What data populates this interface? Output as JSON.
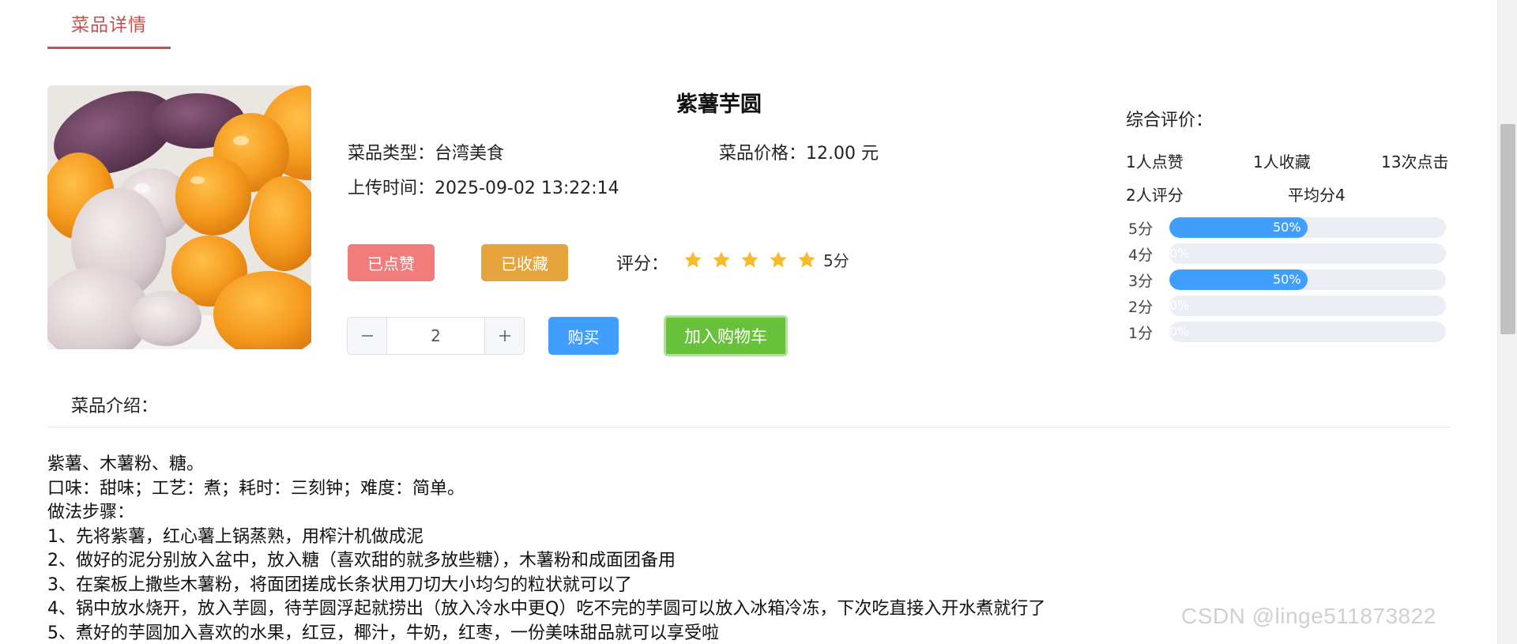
{
  "tab": {
    "label": "菜品详情"
  },
  "dish": {
    "title": "紫薯芋圆",
    "type_label": "菜品类型：",
    "type_value": "台湾美食",
    "price_label": "菜品价格：",
    "price_value": "12.00 元",
    "time_label": "上传时间：",
    "time_value": "2025-09-02 13:22:14"
  },
  "actions": {
    "liked_label": "已点赞",
    "favorited_label": "已收藏",
    "rating_label": "评分：",
    "rating_stars": 5,
    "rating_text": "5分",
    "quantity": "2",
    "buy_label": "购买",
    "cart_label": "加入购物车"
  },
  "summary": {
    "title": "综合评价：",
    "likes": "1人点赞",
    "favorites": "1人收藏",
    "clicks": "13次点击",
    "raters": "2人评分",
    "average": "平均分4",
    "bars": [
      {
        "label": "5分",
        "percent": 50,
        "text": "50%"
      },
      {
        "label": "4分",
        "percent": 0,
        "text": "0%"
      },
      {
        "label": "3分",
        "percent": 50,
        "text": "50%"
      },
      {
        "label": "2分",
        "percent": 0,
        "text": "0%"
      },
      {
        "label": "1分",
        "percent": 0,
        "text": "0%"
      }
    ]
  },
  "description": {
    "heading": "菜品介绍：",
    "lines": [
      "紫薯、木薯粉、糖。",
      "口味：甜味；工艺：煮；耗时：三刻钟；难度：简单。",
      "做法步骤：",
      "1、先将紫薯，红心薯上锅蒸熟，用榨汁机做成泥",
      "2、做好的泥分别放入盆中，放入糖（喜欢甜的就多放些糖），木薯粉和成面团备用",
      "3、在案板上撒些木薯粉，将面团搓成长条状用刀切大小均匀的粒状就可以了",
      "4、锅中放水烧开，放入芋圆，待芋圆浮起就捞出（放入冷水中更Q）吃不完的芋圆可以放入冰箱冷冻，下次吃直接入开水煮就行了",
      "5、煮好的芋圆加入喜欢的水果，红豆，椰汁，牛奶，红枣，一份美味甜品就可以享受啦"
    ]
  },
  "watermark": "CSDN @linge511873822",
  "colors": {
    "tab_accent": "#c0534e",
    "liked": "#f27b7b",
    "favorited": "#e6a43c",
    "star": "#f7ba2a",
    "primary": "#409eff",
    "success": "#67c23a"
  }
}
